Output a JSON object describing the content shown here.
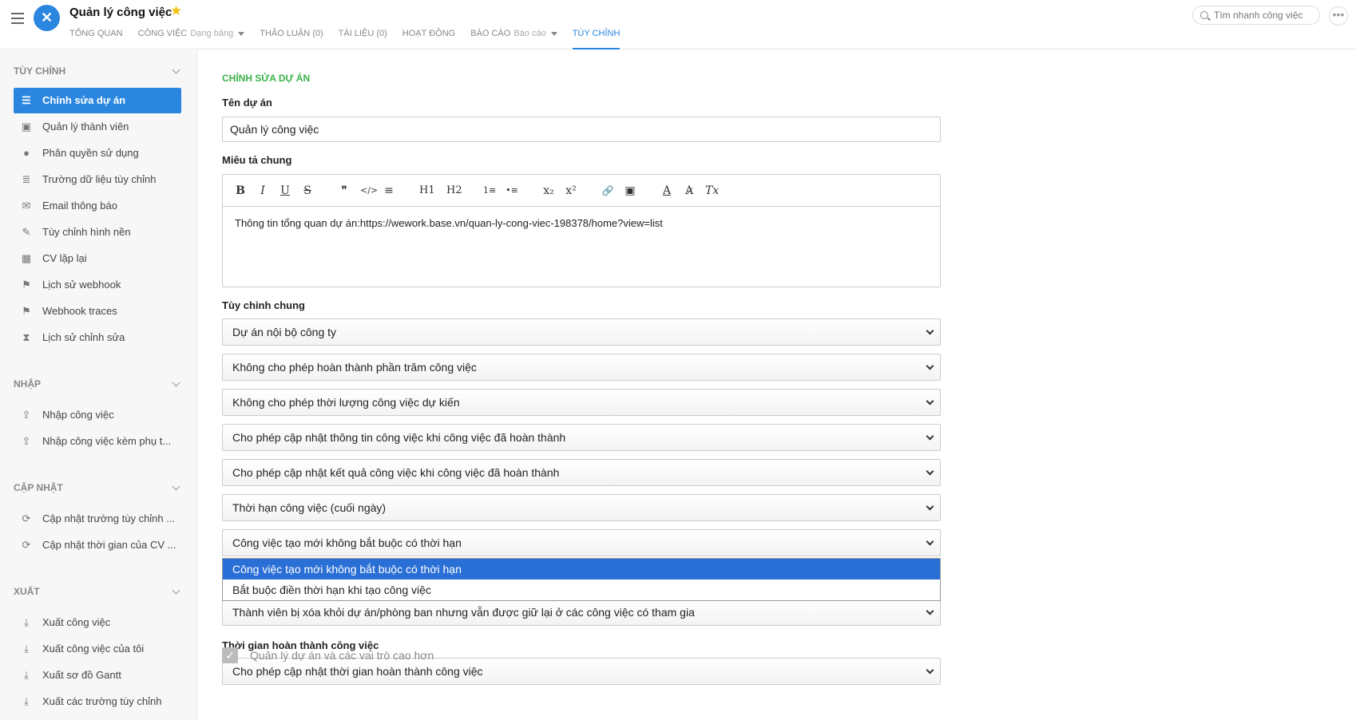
{
  "header": {
    "app_title": "Quản lý công việc",
    "search_placeholder": "Tìm nhanh công việc",
    "nav": [
      {
        "label": "TỔNG QUAN",
        "sub": ""
      },
      {
        "label": "CÔNG VIỆC",
        "sub": "Dạng bảng"
      },
      {
        "label": "THẢO LUẬN (0)",
        "sub": ""
      },
      {
        "label": "TÀI LIỆU (0)",
        "sub": ""
      },
      {
        "label": "HOẠT ĐỘNG",
        "sub": ""
      },
      {
        "label": "BÁO CÁO",
        "sub": "Báo cáo"
      },
      {
        "label": "TÙY CHỈNH",
        "sub": ""
      }
    ]
  },
  "sidebar": {
    "customize_title": "TÙY CHỈNH",
    "customize_items": [
      "Chỉnh sửa dự án",
      "Quản lý thành viên",
      "Phân quyền sử dụng",
      "Trường dữ liệu tùy chỉnh",
      "Email thông báo",
      "Tùy chỉnh hình nền",
      "CV lặp lại",
      "Lịch sử webhook",
      "Webhook traces",
      "Lịch sử chỉnh sửa"
    ],
    "import_title": "NHẬP",
    "import_items": [
      "Nhập công việc",
      "Nhập công việc kèm phụ t..."
    ],
    "update_title": "CẬP NHẬT",
    "update_items": [
      "Cập nhật trường tùy chỉnh ...",
      "Cập nhật thời gian của CV ..."
    ],
    "export_title": "XUẤT",
    "export_items": [
      "Xuất công việc",
      "Xuất công việc của tôi",
      "Xuất sơ đồ Gantt",
      "Xuất các trường tùy chỉnh"
    ]
  },
  "main": {
    "section_label": "CHỈNH SỬA DỰ ÁN",
    "name_label": "Tên dự án",
    "name_value": "Quản lý công việc",
    "desc_label": "Miêu tả chung",
    "desc_value": "Thông tin tổng quan dự án:https://wework.base.vn/quan-ly-cong-viec-198378/home?view=list",
    "toolbar": [
      "B",
      "I",
      "U",
      "S",
      "❞",
      "</>",
      "≡",
      "H1",
      "H2",
      "1≡",
      "•≡",
      "x₂",
      "x²",
      "🔗",
      "▣",
      "A",
      "A̷",
      "Tx"
    ],
    "general_label": "Tùy chỉnh chung",
    "selects": [
      "Dự án nội bộ công ty",
      "Không cho phép hoàn thành phần trăm công việc",
      "Không cho phép thời lượng công việc dự kiến",
      "Cho phép cập nhật thông tin công việc khi công việc đã hoàn thành",
      "Cho phép cập nhật kết quả công việc khi công việc đã hoàn thành",
      "Thời hạn công việc (cuối ngày)",
      "Công việc tạo mới không bắt buộc có thời hạn",
      "Thành viên bị xóa khỏi dự án/phòng ban nhưng vẫn được giữ lại ở các công việc có tham gia"
    ],
    "dropdown_options": [
      "Công việc tạo mới không bắt buộc có thời hạn",
      "Bắt buộc điền thời hạn khi tạo công việc"
    ],
    "completion_label": "Thời gian hoàn thành công việc",
    "completion_select": "Cho phép cập nhật thời gian hoàn thành công việc",
    "checkbox_label": "Quản lý dự án và các vai trò cao hơn"
  }
}
